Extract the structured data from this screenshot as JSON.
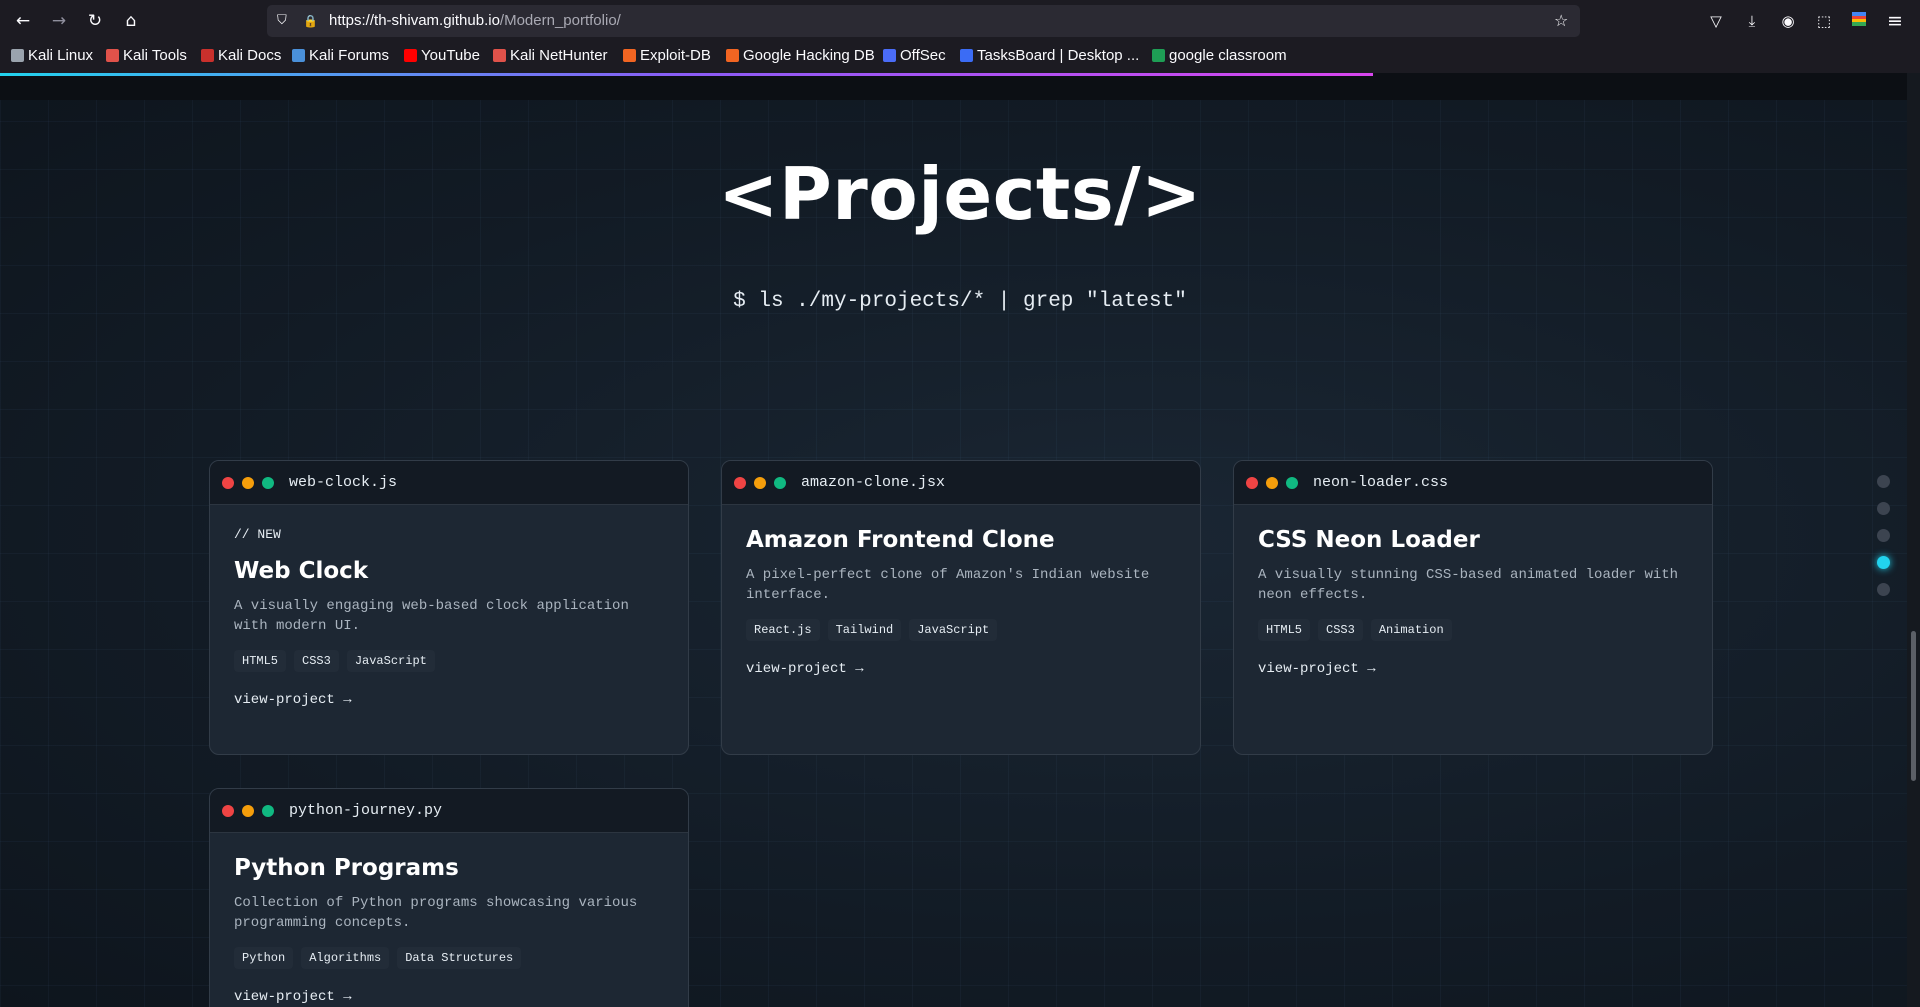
{
  "browser": {
    "url_host": "https://th-shivam.github.io",
    "url_path": "/Modern_portfolio/",
    "bookmarks": [
      {
        "label": "Kali Linux",
        "color": "#9aa3ad"
      },
      {
        "label": "Kali Tools",
        "color": "#e0524a"
      },
      {
        "label": "Kali Docs",
        "color": "#c9302c"
      },
      {
        "label": "Kali Forums",
        "color": "#4a90d9"
      },
      {
        "label": "YouTube",
        "color": "#ff0000"
      },
      {
        "label": "Kali NetHunter",
        "color": "#e0524a"
      },
      {
        "label": "Exploit-DB",
        "color": "#f26522"
      },
      {
        "label": "Google Hacking DB",
        "color": "#f26522"
      },
      {
        "label": "OffSec",
        "color": "#4a6cf7"
      },
      {
        "label": "TasksBoard | Desktop ...",
        "color": "#3b6cf5"
      },
      {
        "label": "google classroom",
        "color": "#1e9e55"
      }
    ],
    "icons": {
      "back": "←",
      "forward": "→",
      "reload": "↻",
      "home": "⌂",
      "shield": "⛉",
      "lock": "🔒",
      "star": "☆",
      "pocket": "▽",
      "download": "⤓",
      "account": "◉",
      "extensions": "⬚",
      "menu": "≡"
    }
  },
  "page": {
    "heading": "<Projects/>",
    "subheading": "$ ls ./my-projects/* | grep \"latest\"",
    "accent": "#22d3ee",
    "side_nav_count": 5,
    "side_nav_active": 3
  },
  "projects": [
    {
      "filename": "web-clock.js",
      "badge": "// NEW",
      "title": "Web Clock",
      "desc": "A visually engaging web-based clock application with modern UI.",
      "tags": [
        "HTML5",
        "CSS3",
        "JavaScript"
      ],
      "link": "view-project →"
    },
    {
      "filename": "amazon-clone.jsx",
      "title": "Amazon Frontend Clone",
      "desc": "A pixel-perfect clone of Amazon's Indian website interface.",
      "tags": [
        "React.js",
        "Tailwind",
        "JavaScript"
      ],
      "link": "view-project →"
    },
    {
      "filename": "neon-loader.css",
      "title": "CSS Neon Loader",
      "desc": "A visually stunning CSS-based animated loader with neon effects.",
      "tags": [
        "HTML5",
        "CSS3",
        "Animation"
      ],
      "link": "view-project →"
    },
    {
      "filename": "python-journey.py",
      "title": "Python Programs",
      "desc": "Collection of Python programs showcasing various programming concepts.",
      "tags": [
        "Python",
        "Algorithms",
        "Data Structures"
      ],
      "link": "view-project →"
    }
  ]
}
